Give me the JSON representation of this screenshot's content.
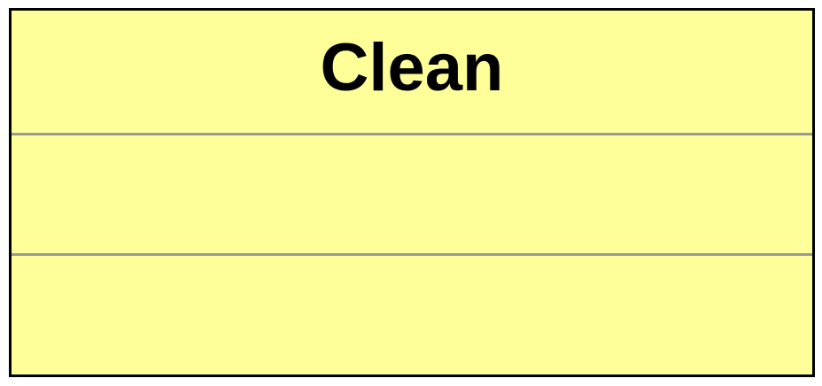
{
  "class_box": {
    "name": "Clean",
    "attributes": [],
    "operations": []
  },
  "colors": {
    "fill": "#ffff99",
    "border": "#000000",
    "divider": "#999999",
    "text": "#000000"
  }
}
